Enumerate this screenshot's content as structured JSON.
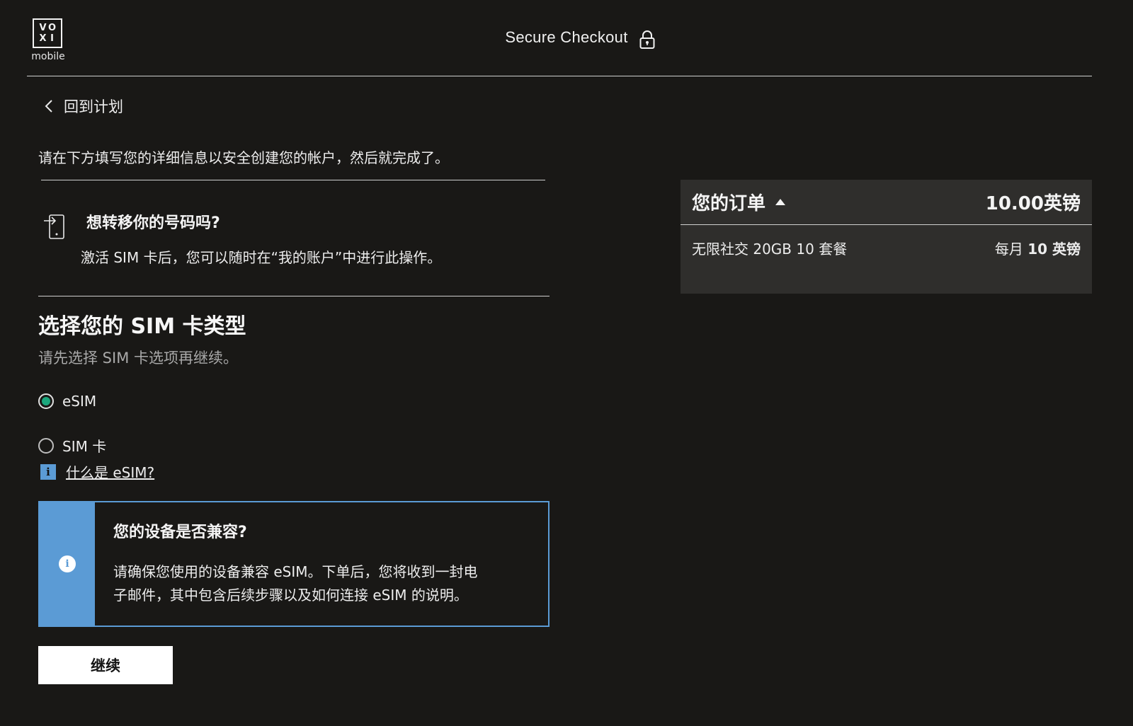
{
  "header": {
    "logo_letters": [
      "V",
      "O",
      "X",
      "I"
    ],
    "logo_sub": "mobile",
    "title": "Secure Checkout"
  },
  "nav": {
    "back_label": "回到计划"
  },
  "intro_text": "请在下方填写您的详细信息以安全创建您的帐户，然后就完成了。",
  "transfer": {
    "title": "想转移你的号码吗?",
    "description": "激活 SIM 卡后，您可以随时在“我的账户”中进行此操作。"
  },
  "sim_type": {
    "title": "选择您的 SIM 卡类型",
    "subtitle": "请先选择 SIM 卡选项再继续。",
    "options": [
      {
        "label": "eSIM",
        "selected": true
      },
      {
        "label": "SIM 卡",
        "selected": false
      }
    ],
    "info_link": "什么是 eSIM? "
  },
  "compat": {
    "title": "您的设备是否兼容?",
    "text_line1": "请确保您使用的设备兼容 eSIM。下单后，您将收到一封电",
    "text_line2": "子邮件，其中包含后续步骤以及如何连接 eSIM 的说明。"
  },
  "continue_label": "继续",
  "order": {
    "title": "您的订单",
    "total": "10.00英镑",
    "plan_name": "无限社交 20GB 10 套餐",
    "plan_price_prefix": "每月 ",
    "plan_price_amount": "10 英镑"
  },
  "colors": {
    "background": "#191816",
    "accent_blue": "#5b9bd5",
    "radio_green": "#1ba77d",
    "panel": "#2f2e2c"
  }
}
